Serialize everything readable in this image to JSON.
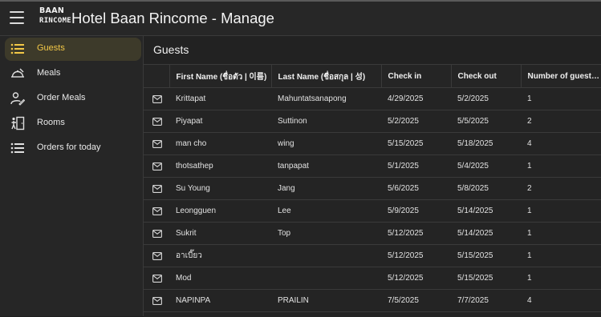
{
  "header": {
    "logo_line1": "BAAN",
    "logo_line2": "RINCOME",
    "title": "Hotel Baan Rincome - Manage"
  },
  "sidebar": {
    "items": [
      {
        "label": "Guests",
        "icon": "list-icon",
        "active": true
      },
      {
        "label": "Meals",
        "icon": "meal-icon",
        "active": false
      },
      {
        "label": "Order Meals",
        "icon": "order-meals-icon",
        "active": false
      },
      {
        "label": "Rooms",
        "icon": "rooms-icon",
        "active": false
      },
      {
        "label": "Orders for today",
        "icon": "list-icon",
        "active": false
      }
    ]
  },
  "main": {
    "title": "Guests",
    "columns": [
      "First Name (ชื่อตัว | 이름)",
      "Last Name (ชื่อสกุล | 성)",
      "Check in",
      "Check out",
      "Number of guests..."
    ],
    "rows": [
      [
        "Krittapat",
        "Mahuntatsanapong",
        "4/29/2025",
        "5/2/2025",
        "1"
      ],
      [
        "Piyapat",
        "Suttinon",
        "5/2/2025",
        "5/5/2025",
        "2"
      ],
      [
        "man cho",
        "wing",
        "5/15/2025",
        "5/18/2025",
        "4"
      ],
      [
        "thotsathep",
        "tanpapat",
        "5/1/2025",
        "5/4/2025",
        "1"
      ],
      [
        "Su Young",
        "Jang",
        "5/6/2025",
        "5/8/2025",
        "2"
      ],
      [
        "Leongguen",
        "Lee",
        "5/9/2025",
        "5/14/2025",
        "1"
      ],
      [
        "Sukrit",
        "Top",
        "5/12/2025",
        "5/14/2025",
        "1"
      ],
      [
        "อาเบี๊ยว",
        "",
        "5/12/2025",
        "5/15/2025",
        "1"
      ],
      [
        "Mod",
        "",
        "5/12/2025",
        "5/15/2025",
        "1"
      ],
      [
        "NAPINPA",
        "PRAILIN",
        "7/5/2025",
        "7/7/2025",
        "4"
      ]
    ]
  },
  "colors": {
    "accent": "#f3c847",
    "active_bg": "#3d3a2a",
    "background": "#1e1e1e"
  }
}
